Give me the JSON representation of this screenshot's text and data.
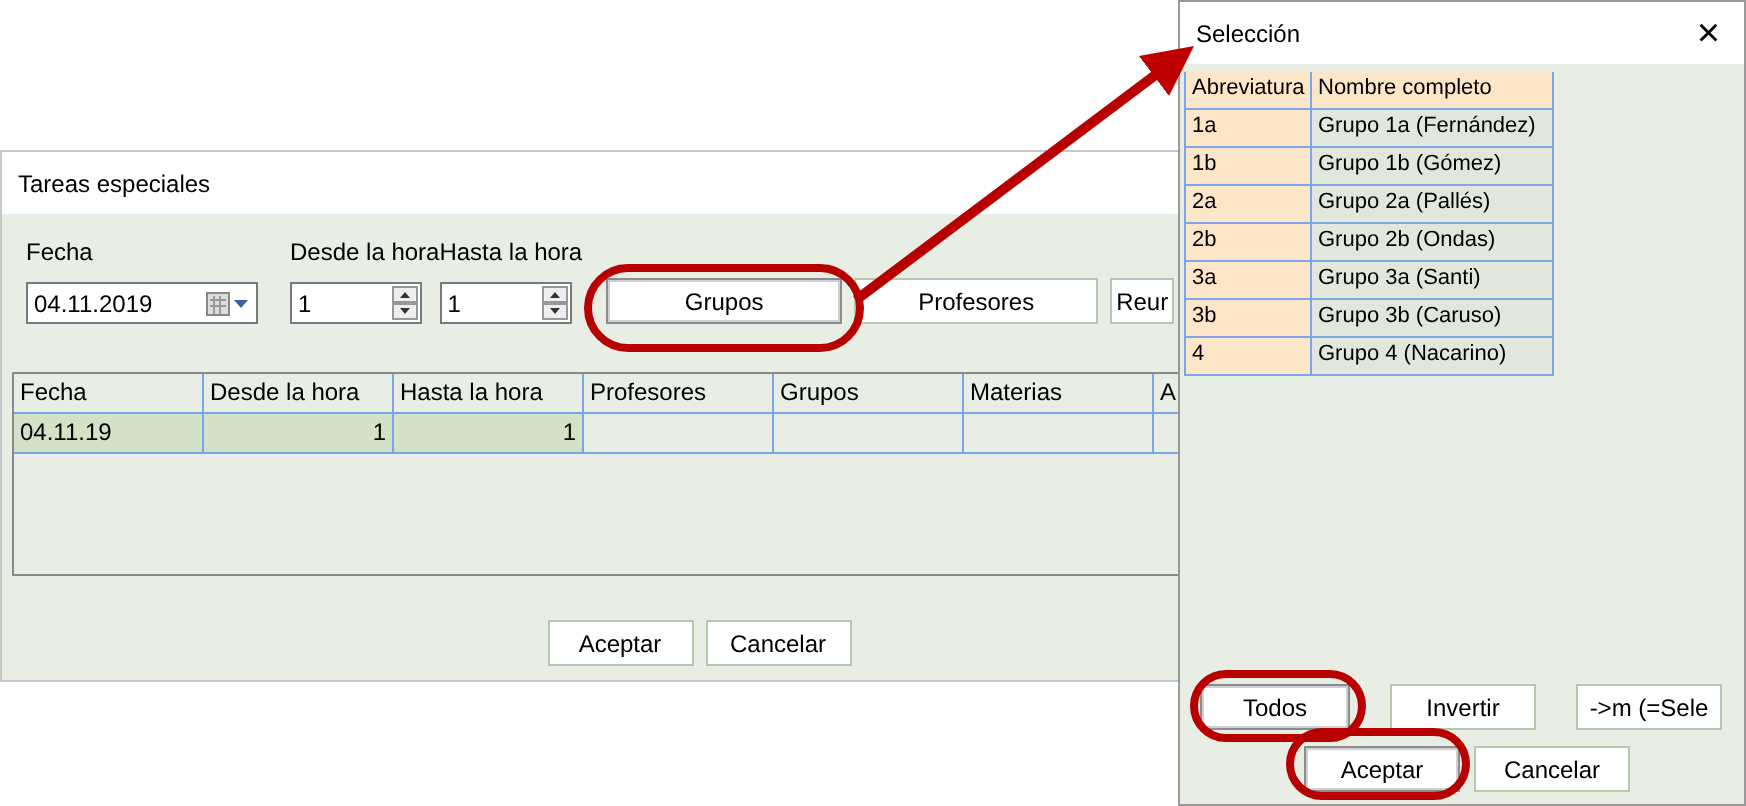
{
  "main_window": {
    "title": "Tareas especiales",
    "fields": {
      "date_label": "Fecha",
      "date_value": "04.11.2019",
      "from_label": "Desde la hora",
      "from_value": "1",
      "to_label": "Hasta la hora",
      "to_value": "1"
    },
    "filter_buttons": [
      {
        "label": "Grupos",
        "highlighted": true
      },
      {
        "label": "Profesores",
        "highlighted": false
      },
      {
        "label": "Reur",
        "highlighted": false
      }
    ],
    "table": {
      "columns": [
        "Fecha",
        "Desde la hora",
        "Hasta la hora",
        "Profesores",
        "Grupos",
        "Materias",
        "A"
      ],
      "rows": [
        {
          "cells": [
            "04.11.19",
            "1",
            "1",
            "",
            "",
            "",
            ""
          ],
          "selected": true
        }
      ]
    },
    "buttons": [
      {
        "label": "Aceptar",
        "highlighted": false
      },
      {
        "label": "Cancelar",
        "highlighted": false
      }
    ]
  },
  "dialog": {
    "title": "Selección",
    "close": "×",
    "table": {
      "columns": [
        "Abreviatura",
        "Nombre completo"
      ],
      "rows": [
        [
          "1a",
          "Grupo 1a (Fernández)"
        ],
        [
          "1b",
          "Grupo 1b (Gómez)"
        ],
        [
          "2a",
          "Grupo 2a (Pallés)"
        ],
        [
          "2b",
          "Grupo 2b (Ondas)"
        ],
        [
          "3a",
          "Grupo 3a (Santi)"
        ],
        [
          "3b",
          "Grupo 3b (Caruso)"
        ],
        [
          "4",
          "Grupo 4 (Nacarino)"
        ]
      ]
    },
    "button_rows": [
      [
        {
          "label": "Todos",
          "highlighted": true
        },
        {
          "label": "Invertir",
          "highlighted": false
        },
        {
          "label": "->m (=Sele",
          "highlighted": false
        }
      ],
      [
        {
          "label": "Aceptar",
          "highlighted": true
        },
        {
          "label": "Cancelar",
          "highlighted": false
        }
      ]
    ]
  }
}
